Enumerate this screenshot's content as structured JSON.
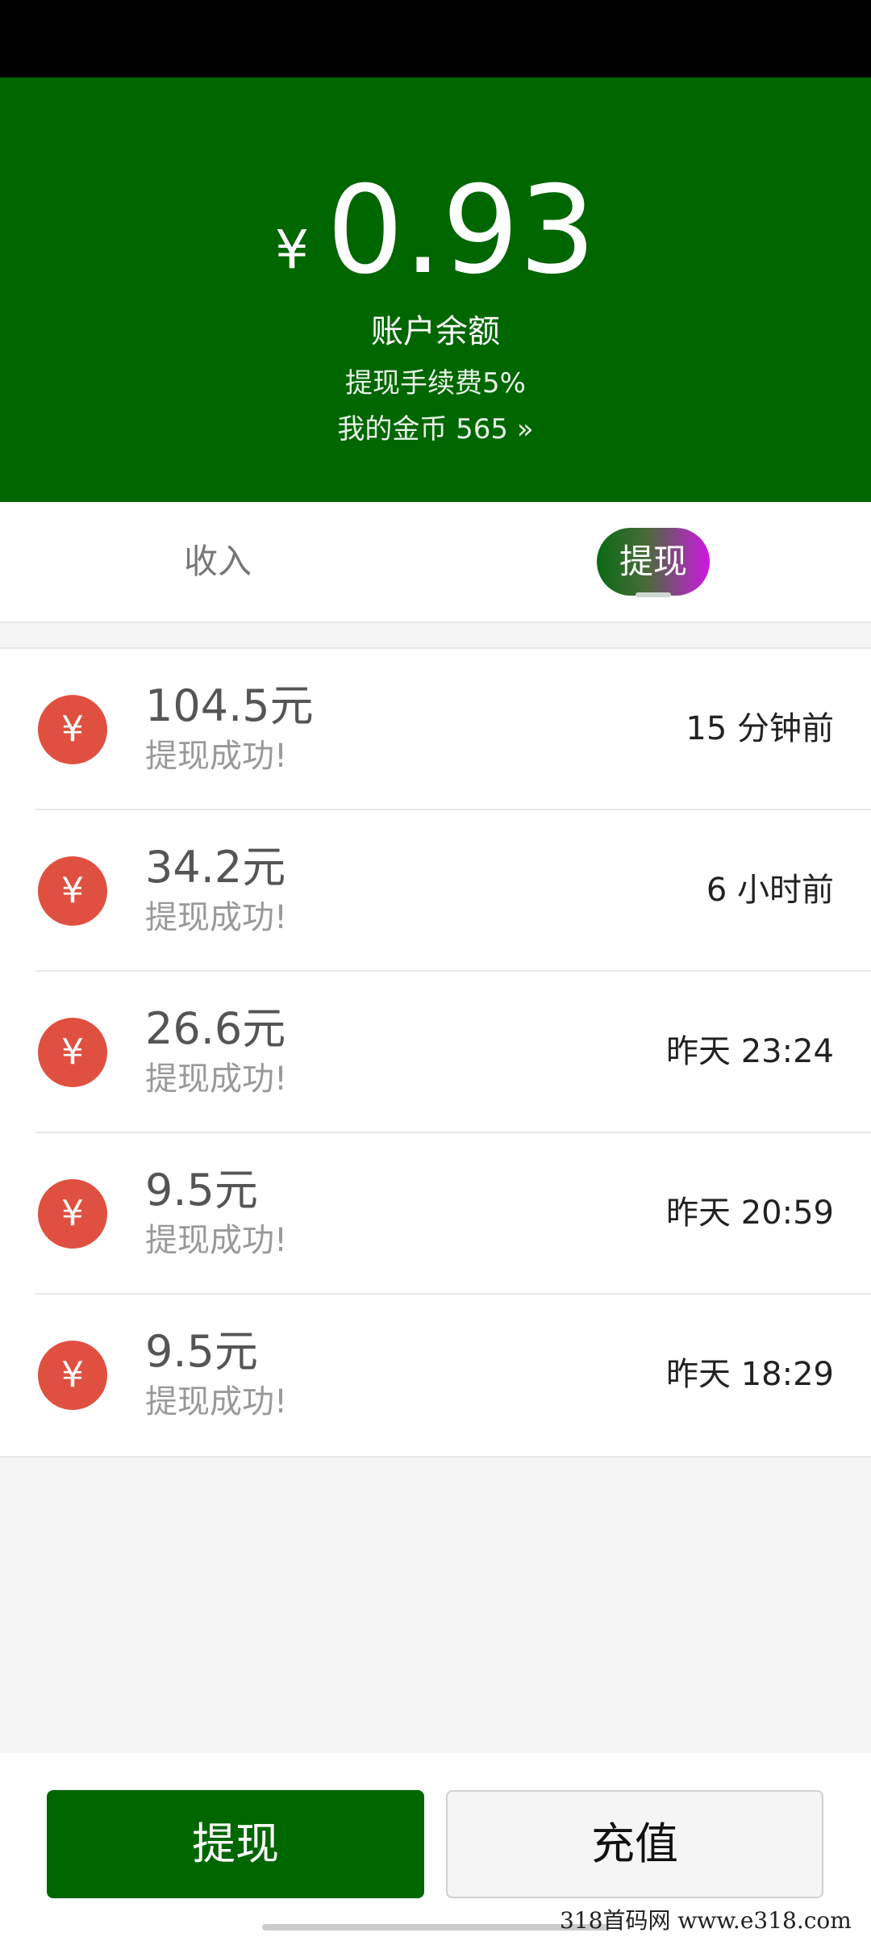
{
  "header": {
    "currency_symbol": "¥",
    "balance": "0.93",
    "balance_label": "账户余额",
    "fee_text": "提现手续费5%",
    "coins_text": "我的金币 565 »",
    "bg_color": "#006600"
  },
  "tabs": [
    {
      "label": "收入",
      "active": false
    },
    {
      "label": "提现",
      "active": true
    }
  ],
  "records": [
    {
      "icon": "yen-icon",
      "symbol": "¥",
      "amount": "104.5元",
      "status": "提现成功!",
      "time": "15 分钟前"
    },
    {
      "icon": "yen-icon",
      "symbol": "¥",
      "amount": "34.2元",
      "status": "提现成功!",
      "time": "6 小时前"
    },
    {
      "icon": "yen-icon",
      "symbol": "¥",
      "amount": "26.6元",
      "status": "提现成功!",
      "time": "昨天 23:24"
    },
    {
      "icon": "yen-icon",
      "symbol": "¥",
      "amount": "9.5元",
      "status": "提现成功!",
      "time": "昨天 20:59"
    },
    {
      "icon": "yen-icon",
      "symbol": "¥",
      "amount": "9.5元",
      "status": "提现成功!",
      "time": "昨天 18:29"
    }
  ],
  "actions": {
    "withdraw_label": "提现",
    "recharge_label": "充值"
  },
  "watermark": "318首码网  www.e318.com",
  "colors": {
    "brand_green": "#006600",
    "badge_red": "#e05040",
    "tab_gradient_end": "#d016e6"
  }
}
